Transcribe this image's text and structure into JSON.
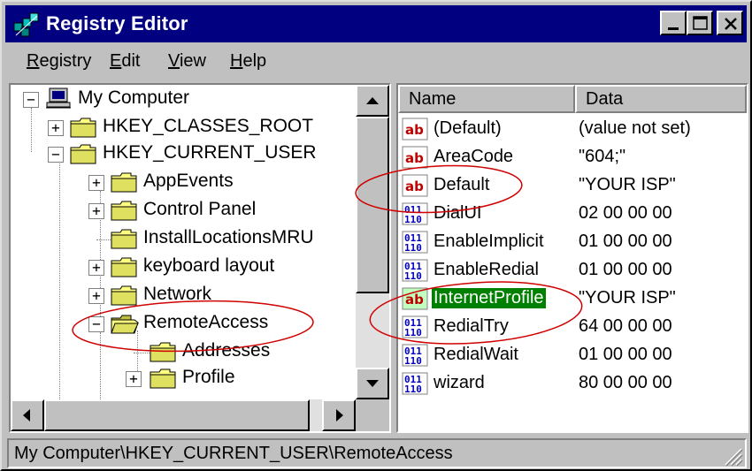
{
  "window": {
    "title": "Registry Editor",
    "app_icon": "registry-editor-icon"
  },
  "titlebar_buttons": [
    "minimize-icon",
    "maximize-icon",
    "close-icon"
  ],
  "menu": [
    {
      "label_u": "R",
      "label_rest": "egistry"
    },
    {
      "label_u": "E",
      "label_rest": "dit"
    },
    {
      "label_u": "V",
      "label_rest": "iew"
    },
    {
      "label_u": "H",
      "label_rest": "elp"
    }
  ],
  "tree": {
    "root": "My Computer",
    "items": [
      {
        "label": "HKEY_CLASSES_ROOT",
        "expander": "+"
      },
      {
        "label": "HKEY_CURRENT_USER",
        "expander": "−"
      },
      {
        "label": "AppEvents",
        "expander": "+"
      },
      {
        "label": "Control Panel",
        "expander": "+"
      },
      {
        "label": "InstallLocationsMRU",
        "expander": ""
      },
      {
        "label": "keyboard layout",
        "expander": "+"
      },
      {
        "label": "Network",
        "expander": "+"
      },
      {
        "label": "RemoteAccess",
        "expander": "−"
      },
      {
        "label": "Addresses",
        "expander": ""
      },
      {
        "label": "Profile",
        "expander": "+"
      }
    ]
  },
  "list": {
    "columns": [
      "Name",
      "Data"
    ],
    "rows": [
      {
        "icon": "string-value-icon",
        "name": "(Default)",
        "data": "(value not set)"
      },
      {
        "icon": "string-value-icon",
        "name": "AreaCode",
        "data": "\"604;\""
      },
      {
        "icon": "string-value-icon",
        "name": "Default",
        "data": "\"YOUR ISP\""
      },
      {
        "icon": "binary-value-icon",
        "name": "DialUI",
        "data": "02 00 00 00"
      },
      {
        "icon": "binary-value-icon",
        "name": "EnableImplicit",
        "data": "01 00 00 00"
      },
      {
        "icon": "binary-value-icon",
        "name": "EnableRedial",
        "data": "01 00 00 00"
      },
      {
        "icon": "string-value-icon",
        "name": "InternetProfile",
        "data": "\"YOUR ISP\"",
        "selected": true
      },
      {
        "icon": "binary-value-icon",
        "name": "RedialTry",
        "data": "64 00 00 00"
      },
      {
        "icon": "binary-value-icon",
        "name": "RedialWait",
        "data": "01 00 00 00"
      },
      {
        "icon": "binary-value-icon",
        "name": "wizard",
        "data": "80 00 00 00"
      }
    ]
  },
  "status": {
    "path": "My Computer\\HKEY_CURRENT_USER\\RemoteAccess"
  },
  "colors": {
    "titlebar": "#000080",
    "selection": "#008000",
    "annotation": "#d00000",
    "chrome": "#c0c0c0"
  }
}
